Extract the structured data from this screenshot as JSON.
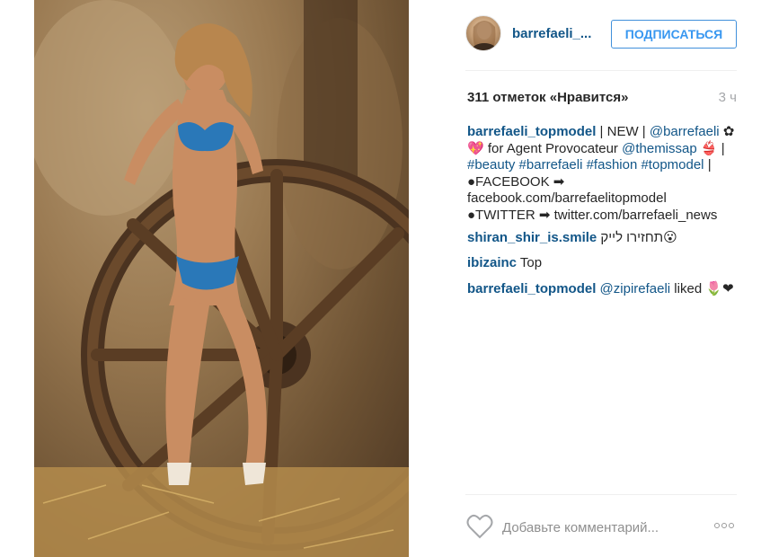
{
  "header": {
    "username": "barrefaeli_...",
    "follow_label": "ПОДПИСАТЬСЯ"
  },
  "stats": {
    "likes": "311 отметок «Нравится»",
    "time": "3 ч"
  },
  "caption": {
    "user": "barrefaeli_topmodel",
    "l1a": " | NEW | ",
    "l1b": "@barrefaeli",
    "l1c": " ✿",
    "l2a": "💖 for Agent Provocateur ",
    "l2b": "@themissap",
    "l2c": " 👙 |",
    "l3": "#beauty #barrefaeli #fashion #topmodel",
    "l3b": " |",
    "l4": "●FACEBOOK ➡",
    "l5": "facebook.com/barrefaelitopmodel",
    "l6": "●TWITTER ➡ twitter.com/barrefaeli_news"
  },
  "comments": [
    {
      "user": "shiran_shir_is.smile",
      "text": "תחזירו לייק😮"
    },
    {
      "user": "ibizainc",
      "text": "Top"
    },
    {
      "user": "barrefaeli_topmodel",
      "mention": "@zipirefaeli",
      "text": " liked 🌷❤"
    }
  ],
  "footer": {
    "comment_placeholder": "Добавьте комментарий..."
  },
  "colors": {
    "link": "#125688",
    "follow": "#3897f0",
    "muted": "#a5a7aa"
  }
}
